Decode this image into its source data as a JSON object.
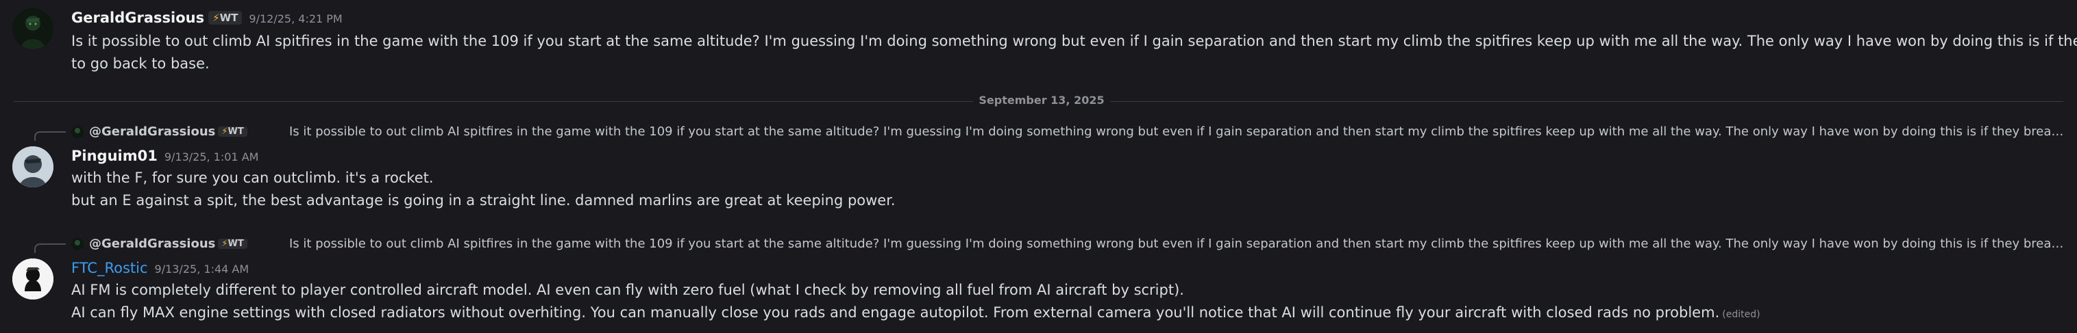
{
  "divider": {
    "label": "September 13, 2025"
  },
  "messages": [
    {
      "author": "GeraldGrassious",
      "tag": "WT",
      "timestamp": "9/12/25, 4:21 PM",
      "lines": [
        "Is it possible to out climb AI spitfires in the game with the 109 if you start at the same altitude? I'm guessing I'm doing something wrong but even if I gain separation and then start my climb the spitfires keep up with me all the way. The only way I have won by doing this is if they break off",
        "to go back to base."
      ]
    },
    {
      "reply": {
        "author": "@GeraldGrassious",
        "tag": "WT",
        "text": "Is it possible to out climb AI spitfires in the game with the 109 if you start at the same altitude? I'm guessing I'm doing something wrong but even if I gain separation and then start my climb the spitfires keep up with me all the way. The only way I have won by doing this is if they break off to go back to base."
      },
      "author": "Pinguim01",
      "timestamp": "9/13/25, 1:01 AM",
      "lines": [
        "with the F, for sure you can outclimb. it's a rocket.",
        "but an E against a spit, the best advantage is going in a straight line. damned marlins are great at keeping power."
      ]
    },
    {
      "reply": {
        "author": "@GeraldGrassious",
        "tag": "WT",
        "text": "Is it possible to out climb AI spitfires in the game with the 109 if you start at the same altitude? I'm guessing I'm doing something wrong but even if I gain separation and then start my climb the spitfires keep up with me all the way. The only way I have won by doing this is if they break off to go back to base."
      },
      "author": "FTC_Rostic",
      "timestamp": "9/13/25, 1:44 AM",
      "lines": [
        "AI FM is completely different to player controlled aircraft model. AI even can fly with zero fuel (what I check by removing all fuel from AI aircraft by script).",
        "AI can fly MAX engine settings with closed radiators without overhiting. You can manually close you rads and engage autopilot. From external camera you'll notice that AI will continue fly your aircraft with closed rads no problem."
      ],
      "edited_label": "(edited)"
    }
  ],
  "icons": {
    "tag_icon": "lightning-bolt-icon"
  },
  "colors": {
    "background": "#1a1a1e",
    "author_blue": "#3a9df0",
    "bolt": "#f0b232"
  }
}
